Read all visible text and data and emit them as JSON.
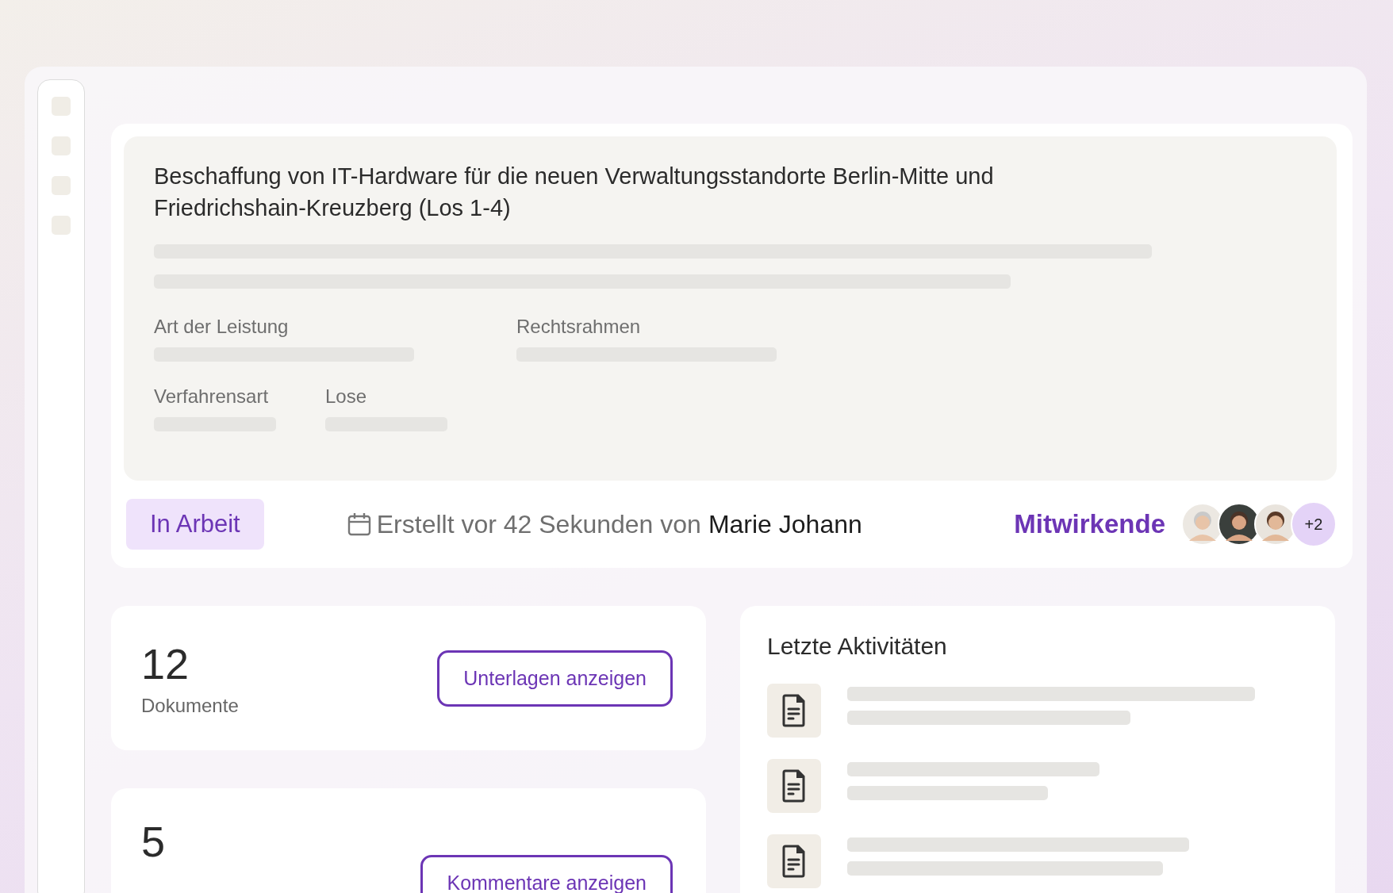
{
  "sidebar": {
    "items": [
      {
        "kind": "placeholder"
      },
      {
        "kind": "placeholder"
      },
      {
        "kind": "placeholder"
      },
      {
        "kind": "placeholder"
      }
    ]
  },
  "procurement": {
    "title": "Beschaffung von IT-Hardware für die neuen Verwaltungsstandorte Berlin-Mitte und Friedrichshain-Kreuzberg (Los 1-4)",
    "fields": [
      {
        "label": "Art der Leistung"
      },
      {
        "label": "Rechtsrahmen"
      },
      {
        "label": "Verfahrensart"
      },
      {
        "label": "Lose"
      }
    ],
    "status": "In Arbeit",
    "created": "Erstellt vor 42 Sekunden von",
    "author": "Marie Johann",
    "contributors_label": "Mitwirkende",
    "more_contributors": "+2"
  },
  "stats": [
    {
      "count": "12",
      "label": "Dokumente",
      "button": "Unterlagen anzeigen"
    },
    {
      "count": "5",
      "button": "Kommentare anzeigen"
    }
  ],
  "activity": {
    "title": "Letzte Aktivitäten",
    "items": [
      {
        "kind": "document"
      },
      {
        "kind": "document"
      },
      {
        "kind": "document"
      }
    ]
  }
}
